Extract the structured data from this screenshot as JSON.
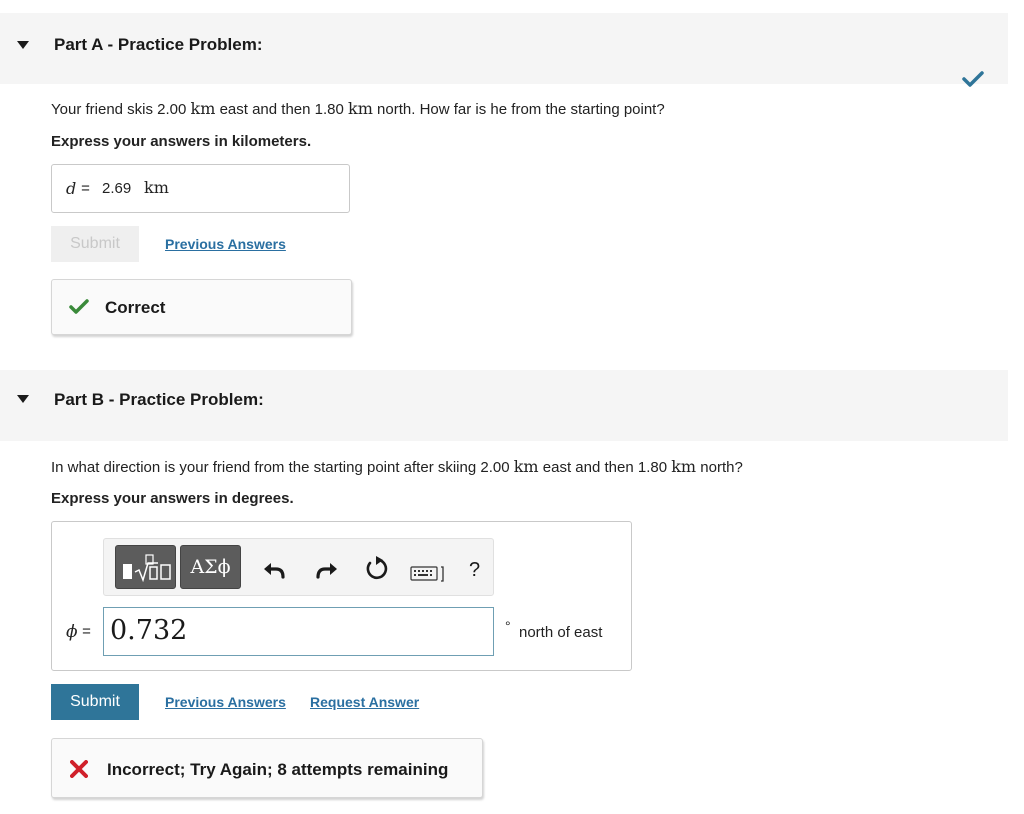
{
  "partA": {
    "title": "Part A - Practice Problem:",
    "question_pre": "Your friend skis 2.00 ",
    "question_unit1": "km",
    "question_mid": " east and then 1.80 ",
    "question_unit2": "km",
    "question_post": " north. How far is he from the starting point?",
    "instruction": "Express your answers in kilometers.",
    "answer_var": "d",
    "answer_eq": " = ",
    "answer_value": "2.69",
    "answer_unit": "km",
    "submit_label": "Submit",
    "previous_answers_label": "Previous Answers",
    "feedback_text": "Correct"
  },
  "partB": {
    "title": "Part B - Practice Problem:",
    "question_pre": "In what direction is your friend from the starting point after skiing 2.00 ",
    "question_unit1": "km",
    "question_mid": " east and then 1.80 ",
    "question_unit2": "km",
    "question_post": " north?",
    "instruction": "Express your answers in degrees.",
    "toolbar": {
      "greek_label": "ΑΣϕ",
      "help_label": "?"
    },
    "answer_var": "ϕ",
    "answer_eq": " =",
    "answer_value": "0.732",
    "unit_symbol": "°",
    "unit_text": "north of east",
    "submit_label": "Submit",
    "previous_answers_label": "Previous Answers",
    "request_answer_label": "Request Answer",
    "feedback_text": "Incorrect; Try Again; 8 attempts remaining"
  },
  "colors": {
    "accent": "#2f7599",
    "link": "#2a6fa1",
    "correct": "#3a8a3a",
    "incorrect": "#d0202a",
    "header_bg": "#f5f5f5"
  }
}
